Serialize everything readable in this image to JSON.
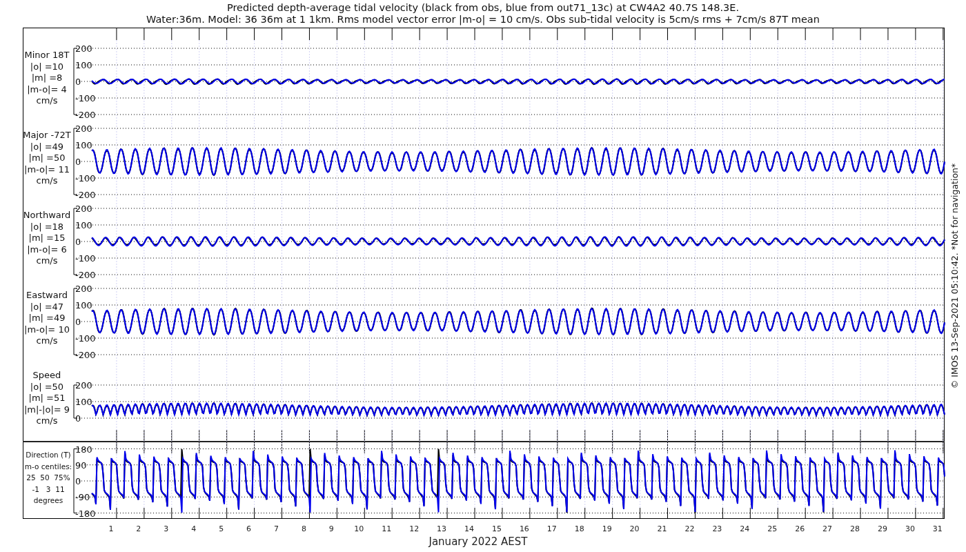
{
  "title": [
    "Predicted depth-average tidal velocity (black from obs, blue from out71_13c) at CW4A2 40.7S 148.3E.",
    "Water:36m. Model: 36 36m at 1 1km. Rms model vector error |m-o| = 10 cm/s. Obs sub-tidal velocity is 5cm/s rms + 7cm/s 87T mean"
  ],
  "panels": [
    {
      "kind": "minor",
      "label_lines": [
        "Minor 18T",
        "|o| =10",
        "|m| =8",
        "|m-o|= 4",
        "cm/s"
      ],
      "yticks": [
        "200",
        "100",
        "0",
        "-100",
        "-200"
      ]
    },
    {
      "kind": "major",
      "label_lines": [
        "Major -72T",
        "|o| =49",
        "|m| =50",
        "|m-o|= 11",
        "cm/s"
      ],
      "yticks": [
        "200",
        "100",
        "0",
        "-100",
        "-200"
      ]
    },
    {
      "kind": "north",
      "label_lines": [
        "Northward",
        "|o| =18",
        "|m| =15",
        "|m-o|= 6",
        "cm/s"
      ],
      "yticks": [
        "200",
        "100",
        "0",
        "-100",
        "-200"
      ]
    },
    {
      "kind": "east",
      "label_lines": [
        "Eastward",
        "|o| =47",
        "|m| =49",
        "|m-o|= 10",
        "cm/s"
      ],
      "yticks": [
        "200",
        "100",
        "0",
        "-100",
        "-200"
      ]
    },
    {
      "kind": "speed",
      "label_lines": [
        "Speed",
        "|o| =50",
        "|m| =51",
        "|m|-|o|= 9",
        "cm/s"
      ],
      "yticks": [
        "200",
        "100",
        "0"
      ]
    },
    {
      "kind": "direction",
      "label_lines": [
        "Direction (T)",
        "m-o centiles:",
        "25  50  75%",
        "-1   3  11",
        "degrees"
      ],
      "yticks": [
        "180",
        "90",
        "0",
        "-90",
        "-180"
      ]
    }
  ],
  "x_axis": {
    "ticks": [
      "1",
      "2",
      "3",
      "4",
      "5",
      "6",
      "7",
      "8",
      "9",
      "10",
      "11",
      "12",
      "13",
      "14",
      "15",
      "16",
      "17",
      "18",
      "19",
      "20",
      "21",
      "22",
      "23",
      "24",
      "25",
      "26",
      "27",
      "28",
      "29",
      "30",
      "31"
    ],
    "label": "January 2022 AEST"
  },
  "footer_note": "© IMOS 13-Sep-2021 05:10:42. *Not for navigation*"
}
